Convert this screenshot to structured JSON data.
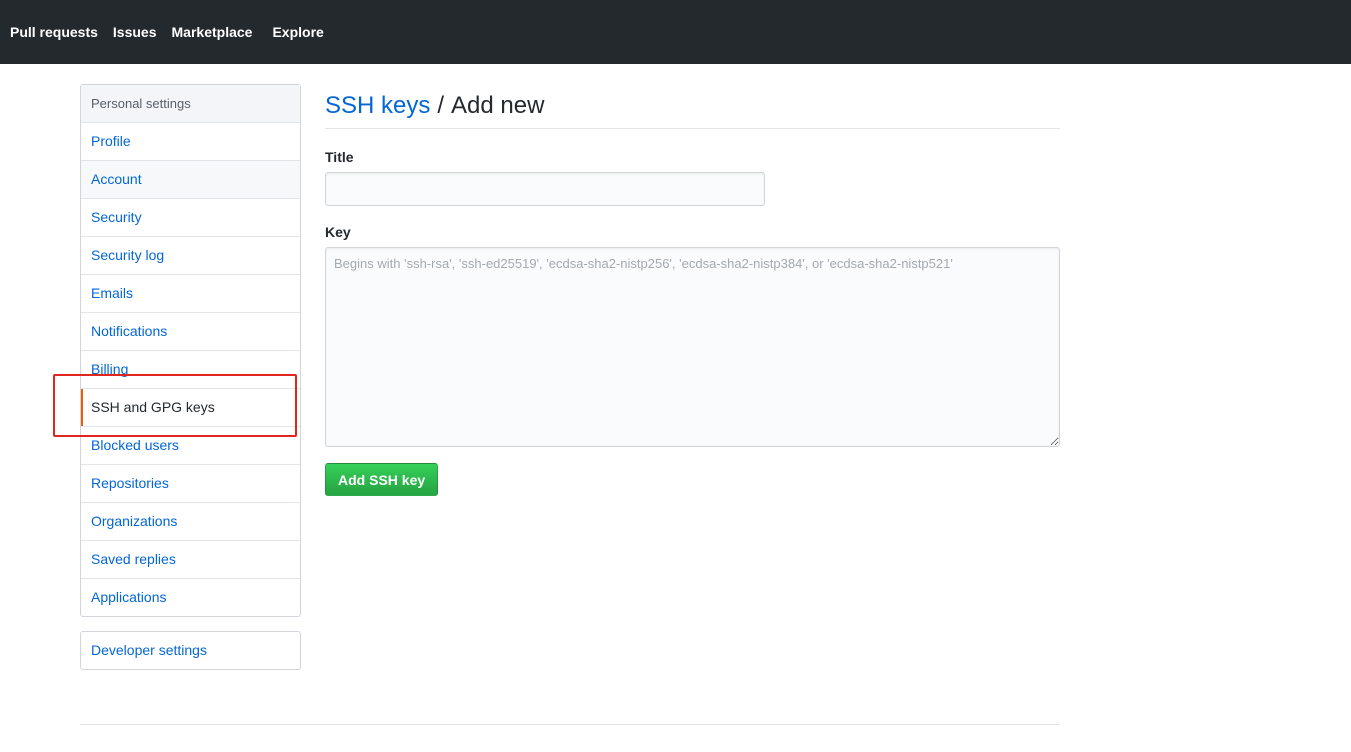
{
  "topnav": {
    "items": [
      "Pull requests",
      "Issues",
      "Marketplace",
      "Explore"
    ]
  },
  "sidebar": {
    "heading": "Personal settings",
    "items": [
      {
        "label": "Profile"
      },
      {
        "label": "Account"
      },
      {
        "label": "Security"
      },
      {
        "label": "Security log"
      },
      {
        "label": "Emails"
      },
      {
        "label": "Notifications"
      },
      {
        "label": "Billing"
      },
      {
        "label": "SSH and GPG keys",
        "selected": true
      },
      {
        "label": "Blocked users"
      },
      {
        "label": "Repositories"
      },
      {
        "label": "Organizations"
      },
      {
        "label": "Saved replies"
      },
      {
        "label": "Applications"
      }
    ],
    "developer": {
      "label": "Developer settings"
    }
  },
  "main": {
    "breadcrumb_link": "SSH keys",
    "separator": "/",
    "page_title": "Add new",
    "title_label": "Title",
    "title_value": "",
    "key_label": "Key",
    "key_placeholder": "Begins with 'ssh-rsa', 'ssh-ed25519', 'ecdsa-sha2-nistp256', 'ecdsa-sha2-nistp384', or 'ecdsa-sha2-nistp521'",
    "submit_label": "Add SSH key"
  },
  "colors": {
    "topbar": "#24292e",
    "link": "#0366d6",
    "selected_indicator": "#e36209",
    "primary_button": "#28a745",
    "annotation_box": "#e0251f"
  }
}
